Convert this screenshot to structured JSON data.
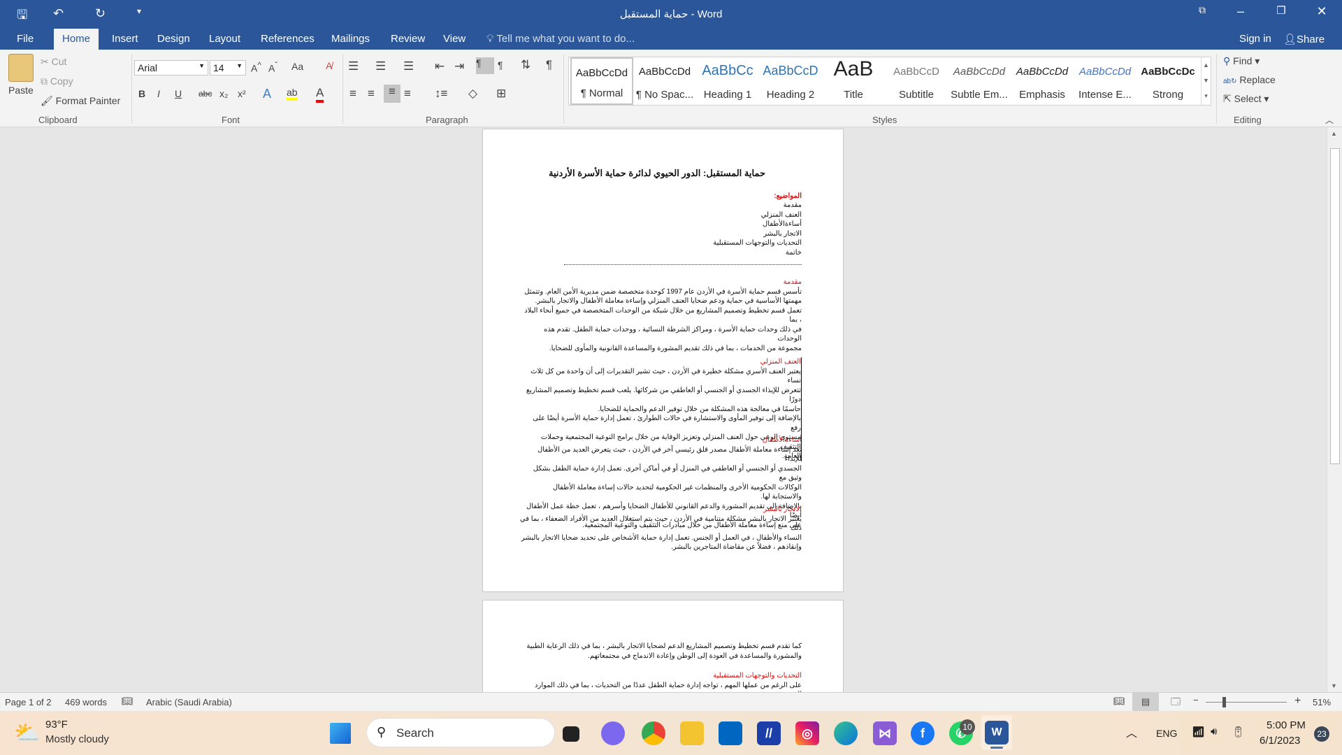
{
  "window": {
    "title": "حماية المستقبل - Word"
  },
  "quick_access": {
    "save": "save-icon",
    "undo": "undo-icon",
    "redo": "redo-icon",
    "customize": "▾"
  },
  "tabs": [
    "File",
    "Home",
    "Insert",
    "Design",
    "Layout",
    "References",
    "Mailings",
    "Review",
    "View"
  ],
  "active_tab": "Home",
  "tell_me": "Tell me what you want to do...",
  "sign_in": "Sign in",
  "share": "Share",
  "clipboard": {
    "paste": "Paste",
    "cut": "Cut",
    "copy": "Copy",
    "format_painter": "Format Painter",
    "label": "Clipboard"
  },
  "font": {
    "name": "Arial",
    "size": "14",
    "label": "Font",
    "case": "Aa",
    "buttons": [
      "B",
      "I",
      "U",
      "abc",
      "x₂",
      "x²"
    ]
  },
  "paragraph": {
    "label": "Paragraph"
  },
  "styles": {
    "label": "Styles",
    "items": [
      {
        "sample": "AaBbCcDd",
        "name": "¶ Normal"
      },
      {
        "sample": "AaBbCcDd",
        "name": "¶ No Spac..."
      },
      {
        "sample": "AaBbCc",
        "name": "Heading 1"
      },
      {
        "sample": "AaBbCcD",
        "name": "Heading 2"
      },
      {
        "sample": "AaB",
        "name": "Title"
      },
      {
        "sample": "AaBbCcD",
        "name": "Subtitle"
      },
      {
        "sample": "AaBbCcDd",
        "name": "Subtle Em..."
      },
      {
        "sample": "AaBbCcDd",
        "name": "Emphasis"
      },
      {
        "sample": "AaBbCcDd",
        "name": "Intense E..."
      },
      {
        "sample": "AaBbCcDc",
        "name": "Strong"
      }
    ]
  },
  "editing": {
    "label": "Editing",
    "find": "Find",
    "replace": "Replace",
    "select": "Select"
  },
  "document": {
    "title": "حماية المستقبل: الدور الحيوي لدائرة حماية الأسرة الأردنية",
    "topics_heading": "المواضيع:",
    "topics": [
      "مقدمة",
      "العنف المنزلي",
      "أساءةالأطفال",
      "الاتجار بالبشر",
      "التحديات والتوجهات المستقبلية",
      "خاتمة"
    ],
    "sections": [
      {
        "heading": "مقدمة",
        "lines": [
          "تأسس قسم حماية الأسرة في الأردن عام 1997 كوحدة متخصصة ضمن مديرية الأمن العام. وتتمثل",
          "مهمتها الأساسية في حماية ودعم ضحايا العنف المنزلي وإساءة معاملة الأطفال والاتجار بالبشر.",
          "تعمل قسم تخطيط وتصميم المشاريع من خلال شبكة من الوحدات المتخصصة في جميع أنحاء البلاد ، بما",
          "في ذلك وحدات حماية الأسرة ، ومراكز الشرطة النسائية ، ووحدات حماية الطفل. تقدم هذه الوحدات",
          "مجموعة من الخدمات ، بما في ذلك تقديم المشورة والمساعدة القانونية والمأوى للضحايا."
        ]
      },
      {
        "heading": "العنف المنزلي",
        "lines": [
          "يعتبر العنف الأسري مشكلة خطيرة في الأردن ، حيث تشير التقديرات إلى أن واحدة من كل ثلاث نساء",
          "تتعرض للإيذاء الجسدي أو الجنسي أو العاطفي من شركائها. يلعب قسم تخطيط وتصميم المشاريع دورًا",
          "حاسمًا في معالجة هذه المشكلة من خلال توفير الدعم والحماية للضحايا.",
          "بالإضافة إلى توفير المأوى والاستشارة في حالات الطوارئ ، تعمل إدارة حماية الأسرة أيضًا على رفع",
          "مستوى الوعي حول العنف المنزلي وتعزيز الوقاية من خلال برامج التوعية المجتمعية وحملات التثقيف",
          "العامة."
        ]
      },
      {
        "heading": "أساءةالأطفال",
        "lines": [
          "تعد إساءة معاملة الأطفال مصدر قلق رئيسي آخر في الأردن ، حيث يتعرض العديد من الأطفال للإيذاء",
          "الجسدي أو الجنسي أو العاطفي في المنزل أو في أماكن أخرى. تعمل إدارة حماية الطفل بشكل وثيق مع",
          "الوكالات الحكومية الأخرى والمنظمات غير الحكومية لتحديد حالات إساءة معاملة الأطفال والاستجابة لها.",
          "بالإضافة إلى تقديم المشورة والدعم القانوني للأطفال الضحايا وأسرهم ، تعمل خطة عمل الأطفال أيضًا",
          "على منع إساءة معاملة الأطفال من خلال مبادرات التثقيف والتوعية المجتمعية."
        ]
      },
      {
        "heading": "الاتجار بالبشر",
        "lines": [
          "يعتبر الاتجار بالبشر مشكلة متنامية في الأردن ، حيث يتم استغلال العديد من الأفراد الضعفاء ، بما في ذلك",
          "النساء والأطفال ، في العمل أو الجنس. تعمل إدارة حماية الأشخاص على تحديد ضحايا الاتجار بالبشر",
          "وإنقاذهم ، فضلاً عن مقاضاة المتاجرين بالبشر."
        ]
      }
    ],
    "page2_lines": [
      "كما تقدم قسم تخطيط وتصميم المشاريع الدعم لضحايا الاتجار بالبشر ، بما في ذلك الرعاية الطبية",
      "والمشورة والمساعدة في العودة إلى الوطن وإعادة الاندماج في مجتمعاتهم."
    ],
    "page2_heading": "التحديات والتوجهات المستقبلية",
    "page2_after": [
      "على الرغم من عملها المهم ، تواجه إدارة حماية الطفل عددًا من التحديات ، بما في ذلك الموارد المحدودة ،"
    ]
  },
  "status": {
    "page": "Page 1 of 2",
    "words": "469 words",
    "language": "Arabic (Saudi Arabia)",
    "zoom": "51%",
    "zoom_value": 51
  },
  "taskbar": {
    "temp": "93°F",
    "weather": "Mostly cloudy",
    "search": "Search",
    "lang": "ENG",
    "time": "5:00 PM",
    "date": "6/1/2023",
    "notifications": "23",
    "whatsapp_badge": "10"
  },
  "colors": {
    "word_blue": "#2b579a",
    "heading_red": "#d01010"
  }
}
